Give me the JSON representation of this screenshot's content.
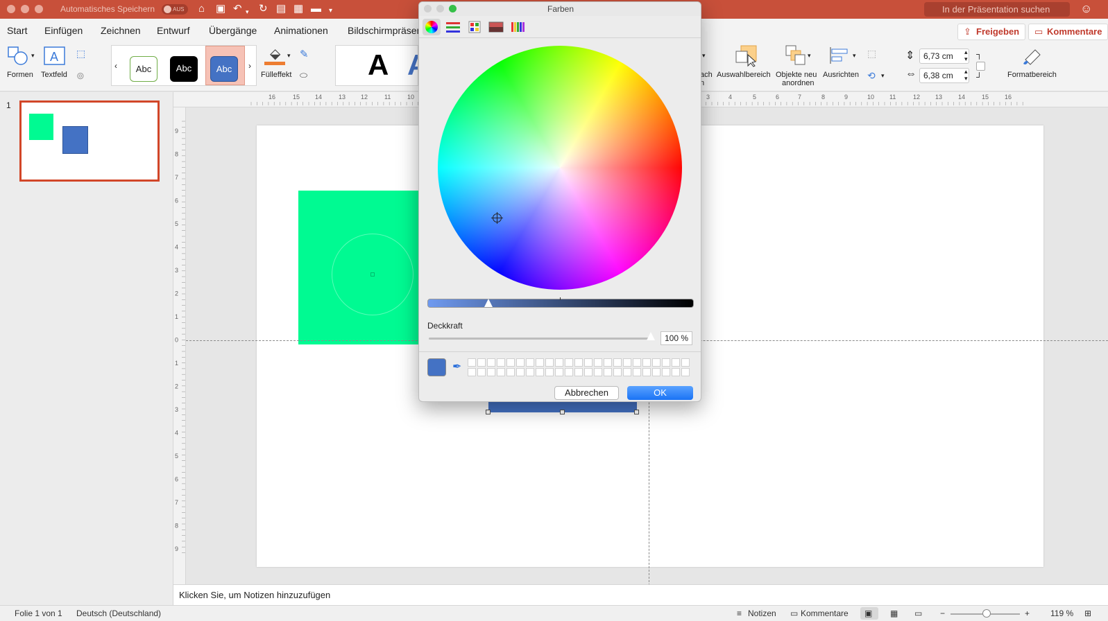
{
  "titlebar": {
    "autosave_label": "Automatisches Speichern",
    "autosave_state": "AUS",
    "search_placeholder": "In der Präsentation suchen"
  },
  "tabs": [
    "Start",
    "Einfügen",
    "Zeichnen",
    "Entwurf",
    "Übergänge",
    "Animationen",
    "Bildschirmpräsentation"
  ],
  "share_label": "Freigeben",
  "comments_label": "Kommentare",
  "ribbon": {
    "shapes_label": "Formen",
    "textbox_label": "Textfeld",
    "style_abc": "Abc",
    "fill_label": "Fülleffekt",
    "wordart_letter": "A",
    "partial_label_1": "ach",
    "partial_label_2": "n",
    "selection_pane": "Auswahlbereich",
    "arrange_line1": "Objekte neu",
    "arrange_line2": "anordnen",
    "align_label": "Ausrichten",
    "height_value": "6,73 cm",
    "width_value": "6,38 cm",
    "format_pane": "Formatbereich"
  },
  "ruler_h_numbers": [
    "16",
    "15",
    "14",
    "13",
    "12",
    "11",
    "10",
    "3",
    "4",
    "5",
    "6",
    "7",
    "8",
    "9",
    "10",
    "11",
    "12",
    "13",
    "14",
    "15",
    "16"
  ],
  "ruler_v_numbers": [
    "9",
    "8",
    "7",
    "6",
    "5",
    "4",
    "3",
    "2",
    "1",
    "0",
    "1",
    "2",
    "3",
    "4",
    "5",
    "6",
    "7",
    "8",
    "9"
  ],
  "thumbnail_number": "1",
  "notes_placeholder": "Klicken Sie, um Notizen hinzuzufügen",
  "statusbar": {
    "slide_info": "Folie 1 von 1",
    "language": "Deutsch (Deutschland)",
    "notes": "Notizen",
    "comments": "Kommentare",
    "zoom": "119 %"
  },
  "color_dialog": {
    "title": "Farben",
    "brightness_fraction": 0.23,
    "opacity_label": "Deckkraft",
    "opacity_value": "100 %",
    "opacity_fraction": 1.0,
    "current_color": "#4472c4",
    "cancel_label": "Abbrechen",
    "ok_label": "OK"
  },
  "colors": {
    "accent": "#c8503a",
    "shape_green": "#00fa92",
    "shape_blue": "#4472c4",
    "selection_red": "#d24628"
  }
}
